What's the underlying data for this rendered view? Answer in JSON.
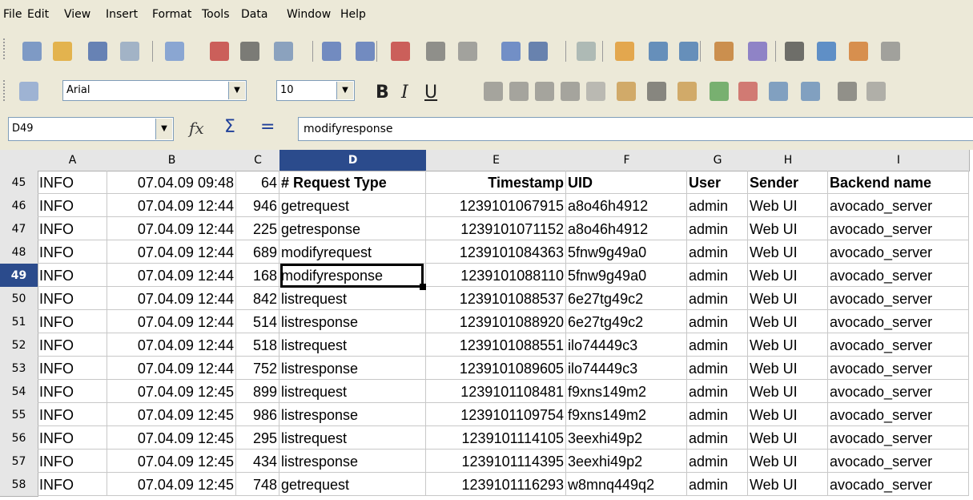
{
  "menu": [
    "File",
    "Edit",
    "View",
    "Insert",
    "Format",
    "Tools",
    "Data",
    "Window",
    "Help"
  ],
  "font_name": "Arial",
  "font_size": "10",
  "name_box": "D49",
  "formula_text": "modifyresponse",
  "formula_icons": {
    "function_wizard": "fx",
    "sum": "Σ",
    "equals": "="
  },
  "format_buttons": {
    "bold": "B",
    "italic": "I",
    "underline": "U"
  },
  "columns": [
    "A",
    "B",
    "C",
    "D",
    "E",
    "F",
    "G",
    "H",
    "I"
  ],
  "selected_column": "D",
  "selected_row": "49",
  "selected_cell": {
    "row": 49,
    "col": "D"
  },
  "rows": [
    {
      "n": "45",
      "cells": [
        "INFO",
        "07.04.09 09:48",
        "64",
        "# Request Type",
        "Timestamp",
        "UID",
        "User",
        "Sender",
        "Backend name"
      ]
    },
    {
      "n": "46",
      "cells": [
        "INFO",
        "07.04.09 12:44",
        "946",
        "getrequest",
        "1239101067915",
        "a8o46h4912",
        "admin",
        "Web UI",
        "avocado_server"
      ]
    },
    {
      "n": "47",
      "cells": [
        "INFO",
        "07.04.09 12:44",
        "225",
        "getresponse",
        "1239101071152",
        "a8o46h4912",
        "admin",
        "Web UI",
        "avocado_server"
      ]
    },
    {
      "n": "48",
      "cells": [
        "INFO",
        "07.04.09 12:44",
        "689",
        "modifyrequest",
        "1239101084363",
        "5fnw9g49a0",
        "admin",
        "Web UI",
        "avocado_server"
      ]
    },
    {
      "n": "49",
      "cells": [
        "INFO",
        "07.04.09 12:44",
        "168",
        "modifyresponse",
        "1239101088110",
        "5fnw9g49a0",
        "admin",
        "Web UI",
        "avocado_server"
      ]
    },
    {
      "n": "50",
      "cells": [
        "INFO",
        "07.04.09 12:44",
        "842",
        "listrequest",
        "1239101088537",
        "6e27tg49c2",
        "admin",
        "Web UI",
        "avocado_server"
      ]
    },
    {
      "n": "51",
      "cells": [
        "INFO",
        "07.04.09 12:44",
        "514",
        "listresponse",
        "1239101088920",
        "6e27tg49c2",
        "admin",
        "Web UI",
        "avocado_server"
      ]
    },
    {
      "n": "52",
      "cells": [
        "INFO",
        "07.04.09 12:44",
        "518",
        "listrequest",
        "1239101088551",
        "ilo74449c3",
        "admin",
        "Web UI",
        "avocado_server"
      ]
    },
    {
      "n": "53",
      "cells": [
        "INFO",
        "07.04.09 12:44",
        "752",
        "listresponse",
        "1239101089605",
        "ilo74449c3",
        "admin",
        "Web UI",
        "avocado_server"
      ]
    },
    {
      "n": "54",
      "cells": [
        "INFO",
        "07.04.09 12:45",
        "899",
        "listrequest",
        "1239101108481",
        "f9xns149m2",
        "admin",
        "Web UI",
        "avocado_server"
      ]
    },
    {
      "n": "55",
      "cells": [
        "INFO",
        "07.04.09 12:45",
        "986",
        "listresponse",
        "1239101109754",
        "f9xns149m2",
        "admin",
        "Web UI",
        "avocado_server"
      ]
    },
    {
      "n": "56",
      "cells": [
        "INFO",
        "07.04.09 12:45",
        "295",
        "listrequest",
        "1239101114105",
        "3eexhi49p2",
        "admin",
        "Web UI",
        "avocado_server"
      ]
    },
    {
      "n": "57",
      "cells": [
        "INFO",
        "07.04.09 12:45",
        "434",
        "listresponse",
        "1239101114395",
        "3eexhi49p2",
        "admin",
        "Web UI",
        "avocado_server"
      ]
    },
    {
      "n": "58",
      "cells": [
        "INFO",
        "07.04.09 12:45",
        "748",
        "getrequest",
        "1239101116293",
        "w8mnq449q2",
        "admin",
        "Web UI",
        "avocado_server"
      ]
    }
  ],
  "toolbar1_icons": [
    "new-icon",
    "open-icon",
    "save-icon",
    "email-icon",
    "edit-mode-icon",
    "export-pdf-icon",
    "print-icon",
    "page-preview-icon",
    "spellcheck-icon",
    "autospellcheck-icon",
    "cut-icon",
    "copy-icon",
    "paste-icon",
    "clone-format-icon",
    "undo-icon",
    "redo-icon",
    "hyperlink-icon",
    "sort-ascending-icon",
    "sort-descending-icon",
    "chart-icon",
    "draw-functions-icon",
    "find-replace-icon",
    "navigator-icon",
    "gallery-icon",
    "data-sources-icon"
  ],
  "toolbar2_icons": [
    "styles-icon",
    "align-left-icon",
    "align-center-icon",
    "align-right-icon",
    "justify-icon",
    "merge-cells-icon",
    "currency-icon",
    "percent-icon",
    "standard-format-icon",
    "add-decimal-icon",
    "delete-decimal-icon",
    "decrease-indent-icon",
    "increase-indent-icon",
    "borders-icon",
    "background-color-icon"
  ]
}
